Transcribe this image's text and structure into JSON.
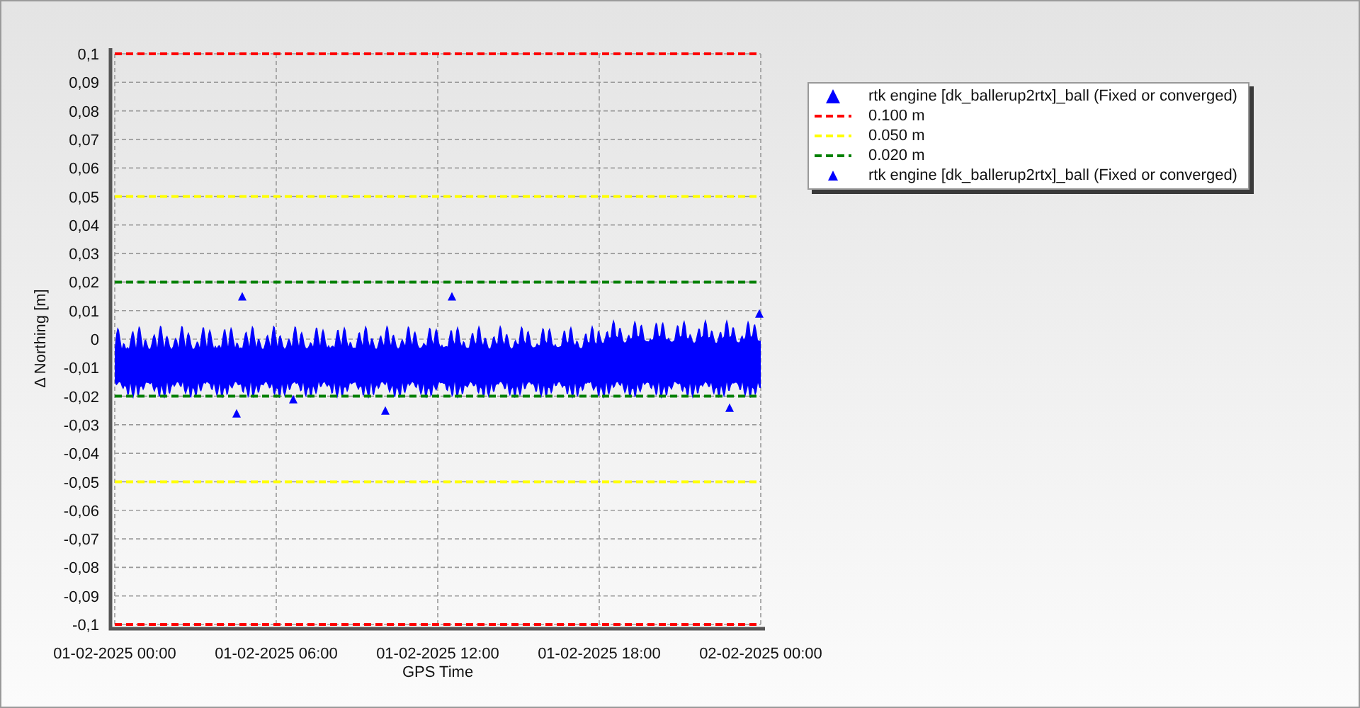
{
  "chart": {
    "chart_data": {
      "type": "line",
      "ylabel": "Δ Northing [m]",
      "xlabel": "GPS Time",
      "grid": true,
      "x": [
        "01-02-2025 00:00",
        "01-02-2025 06:00",
        "01-02-2025 12:00",
        "01-02-2025 18:00",
        "02-02-2025 00:00"
      ],
      "ylim": [
        -0.1,
        0.1
      ],
      "yticks": [
        {
          "value": 0.1,
          "label": "0,1"
        },
        {
          "value": 0.09,
          "label": "0,09"
        },
        {
          "value": 0.08,
          "label": "0,08"
        },
        {
          "value": 0.07,
          "label": "0,07"
        },
        {
          "value": 0.06,
          "label": "0,06"
        },
        {
          "value": 0.05,
          "label": "0,05"
        },
        {
          "value": 0.04,
          "label": "0,04"
        },
        {
          "value": 0.03,
          "label": "0,03"
        },
        {
          "value": 0.02,
          "label": "0,02"
        },
        {
          "value": 0.01,
          "label": "0,01"
        },
        {
          "value": 0,
          "label": "0"
        },
        {
          "value": -0.01,
          "label": "-0,01"
        },
        {
          "value": -0.02,
          "label": "-0,02"
        },
        {
          "value": -0.03,
          "label": "-0,03"
        },
        {
          "value": -0.04,
          "label": "-0,04"
        },
        {
          "value": -0.05,
          "label": "-0,05"
        },
        {
          "value": -0.06,
          "label": "-0,06"
        },
        {
          "value": -0.07,
          "label": "-0,07"
        },
        {
          "value": -0.08,
          "label": "-0,08"
        },
        {
          "value": -0.09,
          "label": "-0,09"
        },
        {
          "value": -0.1,
          "label": "-0,1"
        }
      ],
      "series": [
        {
          "name": "0.100 m",
          "color": "#ff0000",
          "line_style": "dashed",
          "values": [
            0.1,
            0.1,
            0.1,
            0.1,
            0.1
          ]
        },
        {
          "name": "0.050 m",
          "color": "#ffff00",
          "line_style": "dashed",
          "values": [
            0.05,
            0.05,
            0.05,
            0.05,
            0.05
          ]
        },
        {
          "name": "0.020 m",
          "color": "#008000",
          "line_style": "dashed",
          "values": [
            0.02,
            0.02,
            0.02,
            0.02,
            0.02
          ]
        },
        {
          "color": "#008000",
          "line_style": "dashed",
          "values": [
            -0.02,
            -0.02,
            -0.02,
            -0.02,
            -0.02
          ]
        },
        {
          "color": "#ffff00",
          "line_style": "dashed",
          "values": [
            -0.05,
            -0.05,
            -0.05,
            -0.05,
            -0.05
          ]
        },
        {
          "color": "#ff0000",
          "line_style": "dashed",
          "values": [
            -0.1,
            -0.1,
            -0.1,
            -0.1,
            -0.1
          ]
        }
      ]
    }
  },
  "legend": [
    {
      "kind": "marker",
      "color": "#0000ff",
      "label": "rtk engine [dk_ballerup2rtx]_ball (Fixed or converged)"
    },
    {
      "kind": "line"
    },
    {
      "kind": "line"
    },
    {
      "kind": "line"
    },
    {
      "kind": "minimarker",
      "color": "#0000ff",
      "label": "rtk engine [dk_ballerup2rtx]_ball (Fixed or converged)"
    }
  ]
}
